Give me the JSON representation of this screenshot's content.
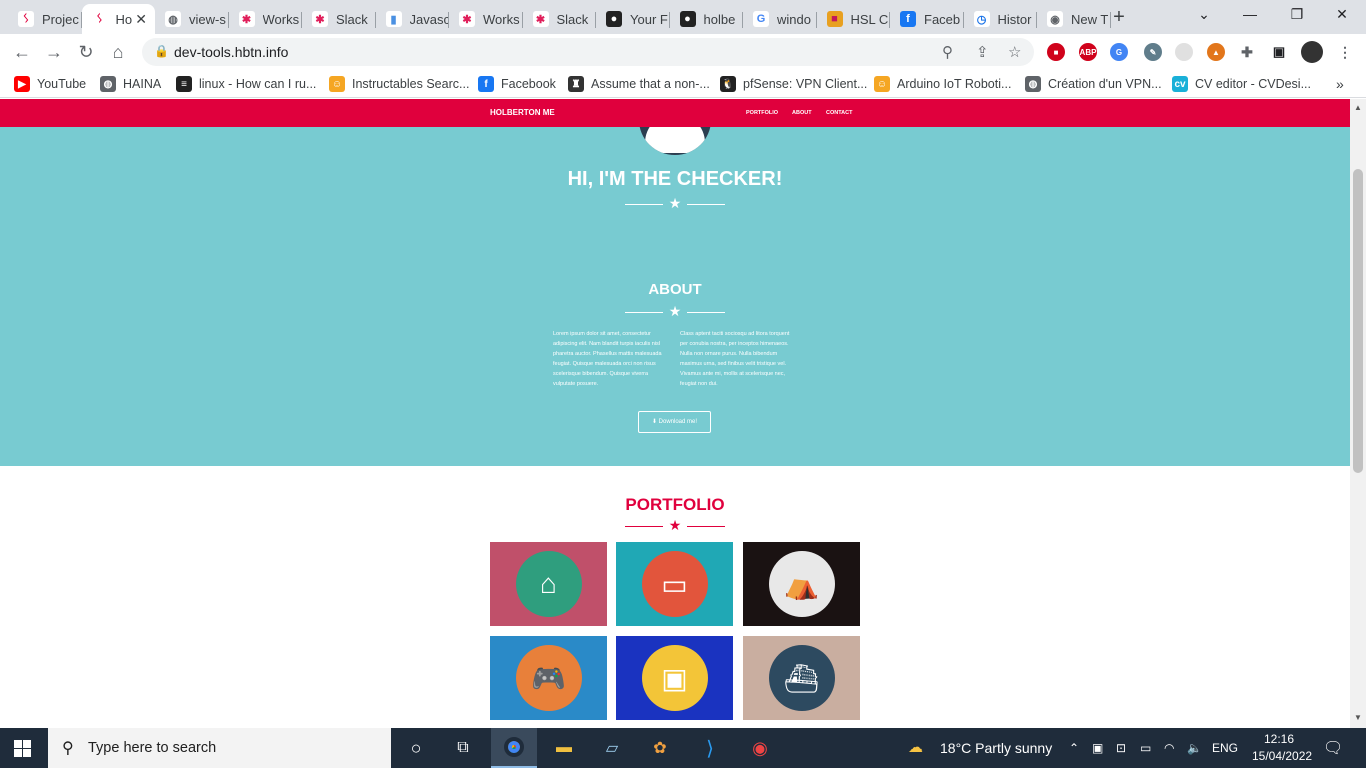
{
  "browser": {
    "tabs": [
      {
        "title": "Projec",
        "icon": "holberton-favicon",
        "active": false
      },
      {
        "title": "Ho",
        "icon": "holberton-favicon",
        "active": true
      },
      {
        "title": "view-s",
        "icon": "globe-icon",
        "active": false
      },
      {
        "title": "Works",
        "icon": "slack-icon",
        "active": false
      },
      {
        "title": "Slack",
        "icon": "slack-icon",
        "active": false
      },
      {
        "title": "Javasc",
        "icon": "database-icon",
        "active": false
      },
      {
        "title": "Works",
        "icon": "slack-icon",
        "active": false
      },
      {
        "title": "Slack",
        "icon": "slack-icon",
        "active": false
      },
      {
        "title": "Your F",
        "icon": "github-icon",
        "active": false
      },
      {
        "title": "holbe",
        "icon": "github-icon",
        "active": false
      },
      {
        "title": "windo",
        "icon": "google-icon",
        "active": false
      },
      {
        "title": "HSL C",
        "icon": "color-icon",
        "active": false
      },
      {
        "title": "Faceb",
        "icon": "facebook-icon",
        "active": false
      },
      {
        "title": "Histor",
        "icon": "history-icon",
        "active": false
      },
      {
        "title": "New T",
        "icon": "chrome-icon",
        "active": false
      }
    ],
    "new_tab_label": "+",
    "url": "dev-tools.hbtn.info",
    "bookmarks": [
      {
        "label": "YouTube",
        "icon": "youtube-icon",
        "color": "#ff0000"
      },
      {
        "label": "HAINA",
        "icon": "globe-icon",
        "color": "#5f6368"
      },
      {
        "label": "linux - How can I ru...",
        "icon": "stackoverflow-icon",
        "color": "#222222"
      },
      {
        "label": "Instructables Searc...",
        "icon": "instructables-icon",
        "color": "#f5a623"
      },
      {
        "label": "Facebook",
        "icon": "facebook-icon",
        "color": "#1877f2"
      },
      {
        "label": "Assume that a non-...",
        "icon": "chess-icon",
        "color": "#333333"
      },
      {
        "label": "pfSense: VPN Client...",
        "icon": "linux-icon",
        "color": "#222222"
      },
      {
        "label": "Arduino IoT Roboti...",
        "icon": "instructables-icon",
        "color": "#f5a623"
      },
      {
        "label": "Création d'un VPN...",
        "icon": "globe-icon",
        "color": "#5f6368"
      },
      {
        "label": "CV editor - CVDesi...",
        "icon": "cv-icon",
        "color": "#1ab0d8"
      }
    ],
    "bookmarks_more": "»"
  },
  "site": {
    "nav": {
      "brand": "HOLBERTON ME",
      "links": [
        "PORTFOLIO",
        "ABOUT",
        "CONTACT"
      ]
    },
    "hero_title": "HI, I'M THE CHECKER!",
    "about": {
      "title": "ABOUT",
      "col1": "Lorem ipsum dolor sit amet, consectetur adipiscing elit. Nam blandit turpis iaculis nisl pharetra auctor. Phasellus mattis malesuada feugiat. Quisque malesuada orci non risus scelerisque bibendum. Quisque viverra vulputate posuere.",
      "col2": "Class aptent taciti sociosqu ad litora torquent per conubia nostra, per inceptos himenaeos. Nulla non ornare purus. Nulla bibendum maximus urna, sed finibus velit tristique vel. Vivamus ante mi, mollis at scelerisque nec, feugiat non dui.",
      "download_label": "Download me!"
    },
    "portfolio": {
      "title": "PORTFOLIO",
      "items": [
        {
          "name": "cabin",
          "bg": "#c0506a",
          "disc": "#2f9e7e"
        },
        {
          "name": "cake",
          "bg": "#20a8b5",
          "disc": "#e2553c"
        },
        {
          "name": "circus",
          "bg": "#1a1212",
          "disc": "#e8e8e8"
        },
        {
          "name": "game-controller",
          "bg": "#2a8ac8",
          "disc": "#e8803a"
        },
        {
          "name": "safe",
          "bg": "#1a33c0",
          "disc": "#f3c538"
        },
        {
          "name": "submarine",
          "bg": "#c9aea0",
          "disc": "#2d4a60"
        }
      ]
    },
    "colors": {
      "primary": "#e0003d",
      "hero_bg": "#78cbd1"
    }
  },
  "taskbar": {
    "search_placeholder": "Type here to search",
    "weather": "18°C  Partly sunny",
    "language": "ENG",
    "time": "12:16",
    "date": "15/04/2022"
  }
}
